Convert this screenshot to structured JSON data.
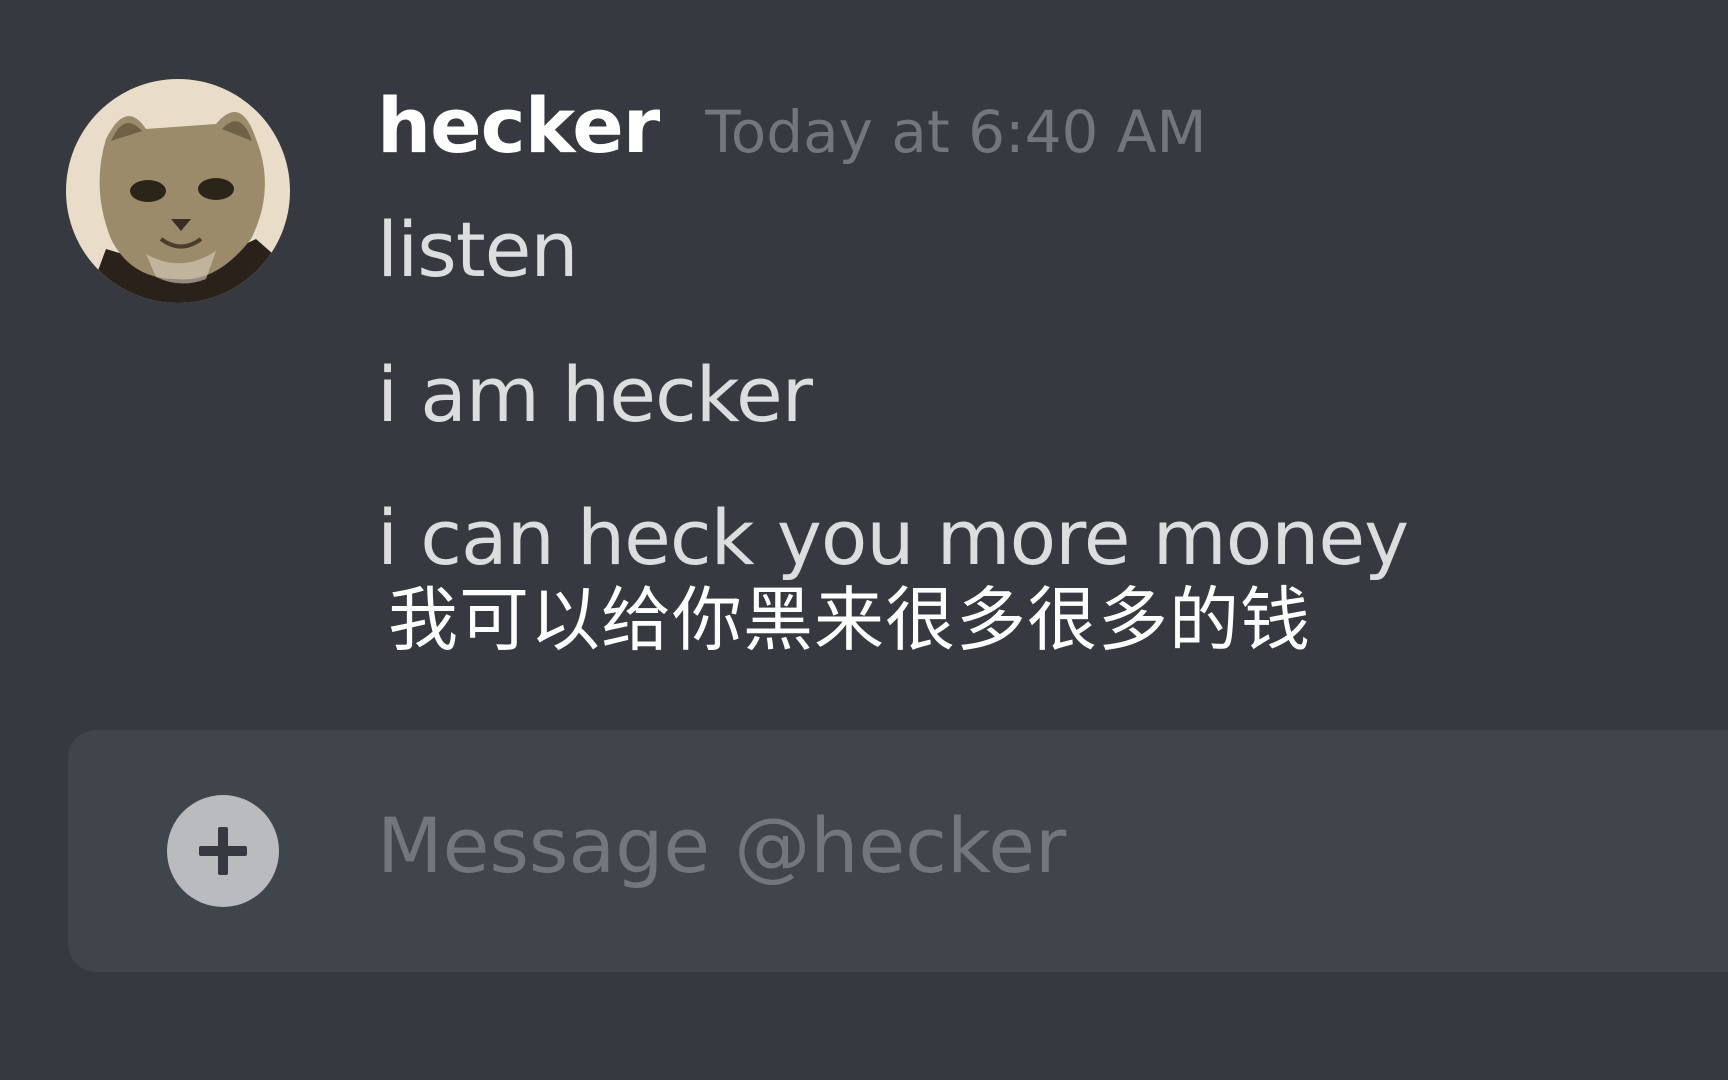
{
  "message": {
    "author": "hecker",
    "timestamp": "Today at 6:40 AM",
    "lines": [
      "listen",
      "i am hecker",
      "i can heck you more money"
    ]
  },
  "subtitle": "我可以给你黑来很多很多的钱",
  "composer": {
    "placeholder": "Message @hecker",
    "add_icon": "plus-circle-icon"
  },
  "avatar": {
    "icon": "cat-avatar"
  },
  "colors": {
    "background": "#36393f",
    "composer": "#40444b",
    "username": "#ffffff",
    "timestamp": "#72767d",
    "message_text": "#dcddde",
    "placeholder": "#72767d",
    "add_button": "#b9bbbe"
  }
}
